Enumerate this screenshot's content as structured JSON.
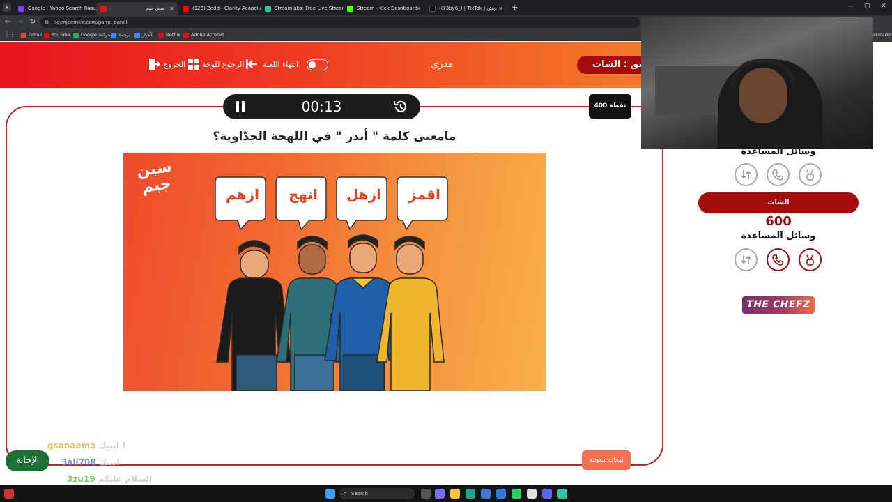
{
  "browser": {
    "tabs": [
      {
        "label": "Google - Yahoo Search Results",
        "color": "#7b3ff2",
        "active": false
      },
      {
        "label": "سين جيم",
        "color": "#e8141c",
        "active": true
      },
      {
        "label": "(126) Zedd - Clarity Acapella C...",
        "color": "#ff0000",
        "active": false
      },
      {
        "label": "Streamlabs: Free Live Streaming...",
        "color": "#31c3a2",
        "active": false
      },
      {
        "label": "Stream - Kick Dashboard",
        "color": "#53fc18",
        "active": false
      },
      {
        "label": "(@3by6_) | TikTok | ريش",
        "color": "#111111",
        "active": false
      }
    ],
    "url": "seenjeemkw.com/game-panel",
    "bookmarks": [
      {
        "label": "Gmail",
        "color": "#ea4335"
      },
      {
        "label": "YouTube",
        "color": "#ff0000"
      },
      {
        "label": "Google خرائط",
        "color": "#34a853"
      },
      {
        "label": "ترجمة",
        "color": "#4285f4"
      },
      {
        "label": "الأخبار",
        "color": "#4285f4"
      },
      {
        "label": "Netflix",
        "color": "#e50914"
      },
      {
        "label": "Adobe Acrobat",
        "color": "#f40f02"
      }
    ],
    "bookmarks_tail": "okmarks"
  },
  "header": {
    "exit_label": "الخروج",
    "back_label": "الرجوع للوحة",
    "end_game_label": "انتهاء اللعبة",
    "host_name": "مدري",
    "team_label": "يق : الشات"
  },
  "game": {
    "timer": "00:13",
    "points": "400 نقطة",
    "question": "مامعنى كلمة \" أندر \" في اللهجة الجدّاوية؟",
    "image": {
      "logo_line1": "سين",
      "logo_line2": "جيم",
      "bubbles": [
        "ازهم",
        "انهج",
        "ازهل",
        "اقمز"
      ]
    },
    "category": "لهجات سعودية",
    "answer_label": "الإجابة"
  },
  "right_panel": {
    "aids_label_top": "وسائل المساعدة",
    "team2_name": "الشات",
    "team2_score": "600",
    "aids_label_bottom": "وسائل المساعدة",
    "sponsor": "THE CHEFZ"
  },
  "chat": [
    {
      "user": "gsanaema",
      "message": "ايبيك !",
      "color": "#e0b84c"
    },
    {
      "user": "3ali708",
      "message": "ايبيك",
      "color": "#5a7fd6"
    },
    {
      "user": "3zu19",
      "message": "السلام عليكم",
      "color": "#6ac24a"
    }
  ],
  "taskbar": {
    "search_placeholder": "Search"
  }
}
